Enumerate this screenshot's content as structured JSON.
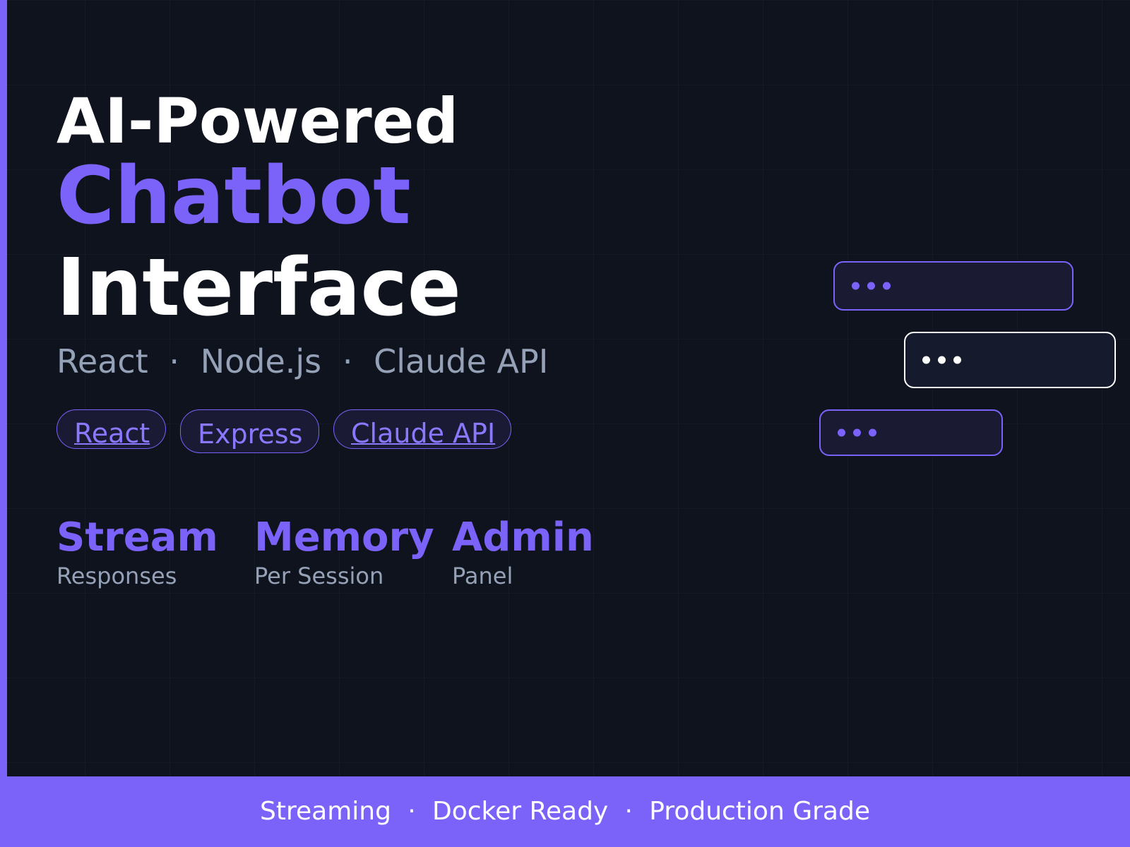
{
  "colors": {
    "background": "#0f131e",
    "accent": "#7b63fa",
    "muted_text": "#94a1b6",
    "white": "#ffffff"
  },
  "hero": {
    "line1": "AI-Powered",
    "line2": "Chatbot",
    "line3": "Interface"
  },
  "stack": {
    "items": [
      "React",
      "Node.js",
      "Claude API"
    ],
    "separator": "·"
  },
  "pills": [
    {
      "label": "React"
    },
    {
      "label": "Express"
    },
    {
      "label": "Claude API"
    }
  ],
  "features": [
    {
      "title": "Stream",
      "subtitle": "Responses"
    },
    {
      "title": "Memory",
      "subtitle": "Per Session"
    },
    {
      "title": "Admin",
      "subtitle": "Panel"
    }
  ],
  "chat_bubbles": [
    {
      "role": "assistant",
      "dots": 3,
      "color": "#7b63fa"
    },
    {
      "role": "user",
      "dots": 3,
      "color": "#ffffff"
    },
    {
      "role": "assistant",
      "dots": 3,
      "color": "#7b63fa"
    }
  ],
  "footer": {
    "items": [
      "Streaming",
      "Docker Ready",
      "Production Grade"
    ],
    "separator": "·"
  }
}
